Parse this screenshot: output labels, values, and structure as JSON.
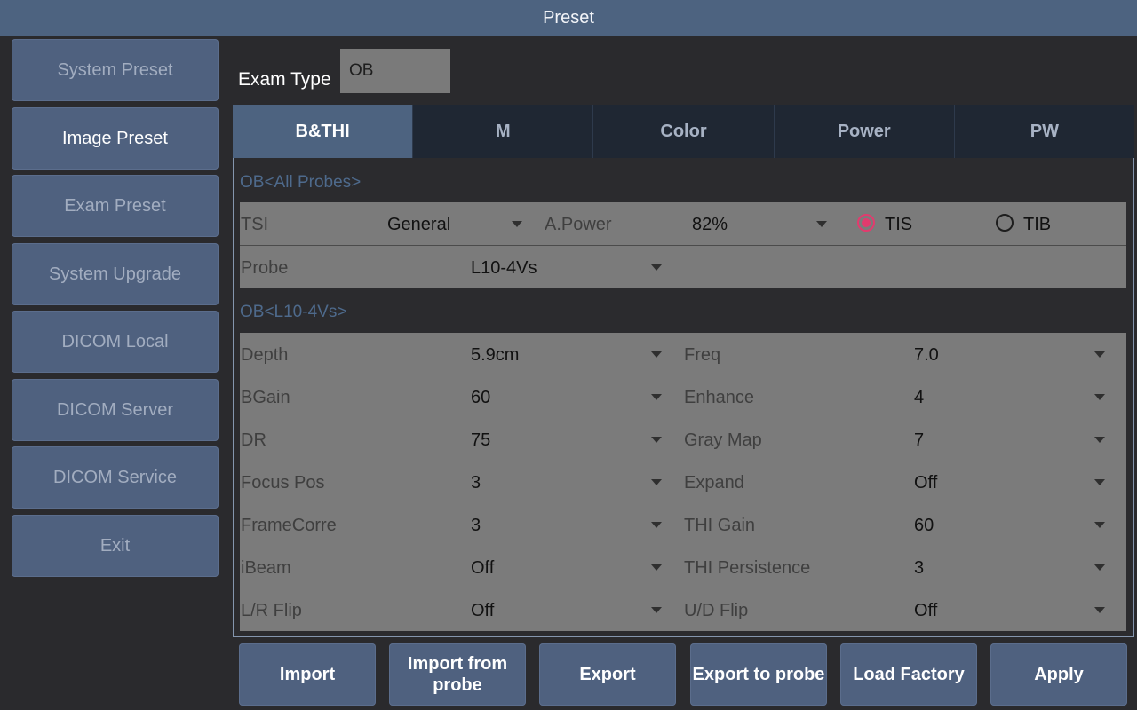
{
  "title": "Preset",
  "sidebar": {
    "items": [
      {
        "label": "System Preset"
      },
      {
        "label": "Image Preset"
      },
      {
        "label": "Exam Preset"
      },
      {
        "label": "System Upgrade"
      },
      {
        "label": "DICOM Local"
      },
      {
        "label": "DICOM Server"
      },
      {
        "label": "DICOM Service"
      },
      {
        "label": "Exit"
      }
    ],
    "active": "Image Preset"
  },
  "exam_type": {
    "label": "Exam Type",
    "value": "OB"
  },
  "tabs": [
    {
      "label": "B&THI"
    },
    {
      "label": "M"
    },
    {
      "label": "Color"
    },
    {
      "label": "Power"
    },
    {
      "label": "PW"
    }
  ],
  "active_tab": "B&THI",
  "all_probes_section": {
    "title": "OB<All Probes>",
    "tsi": {
      "label": "TSI",
      "value": "General"
    },
    "apower": {
      "label": "A.Power",
      "value": "82%"
    },
    "tis": {
      "label": "TIS",
      "selected": true
    },
    "tib": {
      "label": "TIB",
      "selected": false
    },
    "probe": {
      "label": "Probe",
      "value": "L10-4Vs"
    }
  },
  "probe_section": {
    "title": "OB<L10-4Vs>",
    "left": [
      {
        "label": "Depth",
        "value": "5.9cm"
      },
      {
        "label": "BGain",
        "value": "60"
      },
      {
        "label": "DR",
        "value": "75"
      },
      {
        "label": "Focus Pos",
        "value": "3"
      },
      {
        "label": "FrameCorre",
        "value": "3"
      },
      {
        "label": "iBeam",
        "value": "Off"
      },
      {
        "label": "L/R Flip",
        "value": "Off"
      }
    ],
    "right": [
      {
        "label": "Freq",
        "value": "7.0"
      },
      {
        "label": "Enhance",
        "value": "4"
      },
      {
        "label": "Gray Map",
        "value": "7"
      },
      {
        "label": "Expand",
        "value": "Off"
      },
      {
        "label": "THI Gain",
        "value": "60"
      },
      {
        "label": "THI Persistence",
        "value": "3"
      },
      {
        "label": "U/D Flip",
        "value": "Off"
      }
    ]
  },
  "buttons": {
    "import": "Import",
    "import_probe_line1": "Import from",
    "import_probe_line2": "probe",
    "export": "Export",
    "export_probe": "Export to probe",
    "load_factory": "Load Factory",
    "apply": "Apply"
  },
  "colors": {
    "header": "#4d6380",
    "button": "#4f617f",
    "radio_selected": "#e23b6e",
    "section_title": "#4e6a8c"
  }
}
